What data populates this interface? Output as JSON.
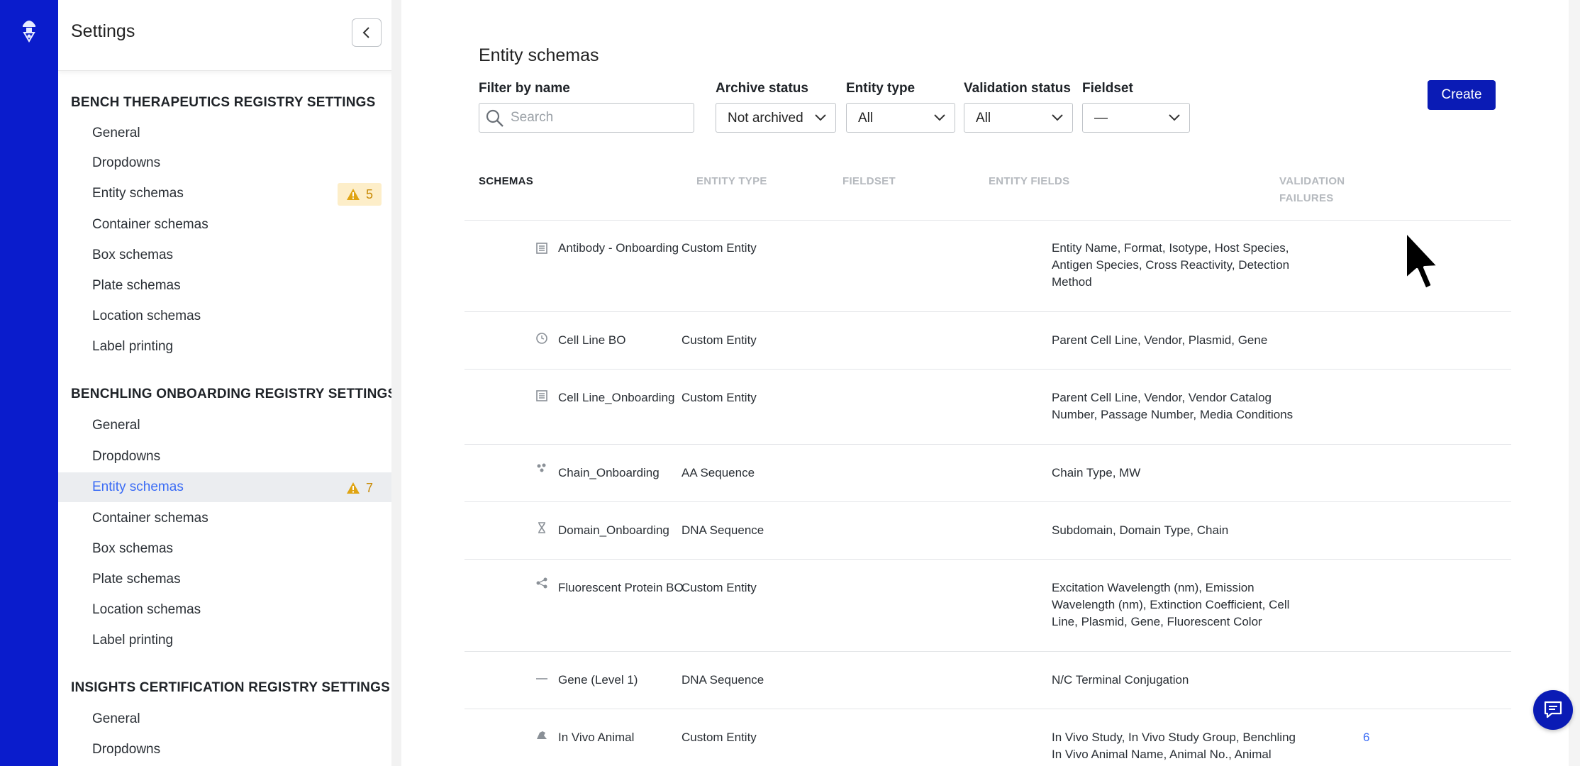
{
  "sidebar": {
    "title": "Settings",
    "sections": [
      {
        "title": "BENCH THERAPEUTICS REGISTRY SETTINGS",
        "items": [
          {
            "label": "General"
          },
          {
            "label": "Dropdowns"
          },
          {
            "label": "Entity schemas",
            "warning_count": "5"
          },
          {
            "label": "Container schemas"
          },
          {
            "label": "Box schemas"
          },
          {
            "label": "Plate schemas"
          },
          {
            "label": "Location schemas"
          },
          {
            "label": "Label printing"
          }
        ]
      },
      {
        "title": "BENCHLING ONBOARDING REGISTRY SETTINGS",
        "items": [
          {
            "label": "General"
          },
          {
            "label": "Dropdowns"
          },
          {
            "label": "Entity schemas",
            "warning_count": "7",
            "active": true
          },
          {
            "label": "Container schemas"
          },
          {
            "label": "Box schemas"
          },
          {
            "label": "Plate schemas"
          },
          {
            "label": "Location schemas"
          },
          {
            "label": "Label printing"
          }
        ]
      },
      {
        "title": "INSIGHTS CERTIFICATION REGISTRY SETTINGS",
        "items": [
          {
            "label": "General"
          },
          {
            "label": "Dropdowns"
          }
        ]
      }
    ]
  },
  "main": {
    "title": "Entity schemas",
    "filters": {
      "name_label": "Filter by name",
      "search_placeholder": "Search",
      "archive_label": "Archive status",
      "archive_value": "Not archived",
      "entity_type_label": "Entity type",
      "entity_type_value": "All",
      "validation_label": "Validation status",
      "validation_value": "All",
      "fieldset_label": "Fieldset",
      "fieldset_value": "—"
    },
    "create_label": "Create",
    "columns": {
      "schemas": "SCHEMAS",
      "entity_type": "ENTITY TYPE",
      "fieldset": "FIELDSET",
      "entity_fields": "ENTITY FIELDS",
      "validation_failures_1": "VALIDATION",
      "validation_failures_2": "FAILURES"
    },
    "rows": [
      {
        "icon": "list-icon",
        "name": "Antibody - Onboarding",
        "entity_type": "Custom Entity",
        "fieldset": "",
        "fields": [
          "Entity Name, Format, Isotype, Host Species,",
          "Antigen Species, Cross Reactivity, Detection",
          "Method"
        ],
        "failures": ""
      },
      {
        "icon": "clock-icon",
        "name": "Cell Line BO",
        "entity_type": "Custom Entity",
        "fieldset": "",
        "fields": [
          "Parent Cell Line, Vendor, Plasmid, Gene"
        ],
        "failures": ""
      },
      {
        "icon": "list-icon",
        "name": "Cell Line_Onboarding",
        "entity_type": "Custom Entity",
        "fieldset": "",
        "fields": [
          "Parent Cell Line, Vendor, Vendor Catalog",
          "Number, Passage Number, Media Conditions"
        ],
        "failures": ""
      },
      {
        "icon": "aa-sequence-icon",
        "name": "Chain_Onboarding",
        "entity_type": "AA Sequence",
        "fieldset": "",
        "fields": [
          "Chain Type, MW"
        ],
        "failures": ""
      },
      {
        "icon": "dna-icon",
        "name": "Domain_Onboarding",
        "entity_type": "DNA Sequence",
        "fieldset": "",
        "fields": [
          "Subdomain, Domain Type, Chain"
        ],
        "failures": ""
      },
      {
        "icon": "molecule-icon",
        "name": "Fluorescent Protein BO",
        "entity_type": "Custom Entity",
        "fieldset": "",
        "fields": [
          "Excitation Wavelength (nm), Emission",
          "Wavelength (nm), Extinction Coefficient, Cell",
          "Line, Plasmid, Gene, Fluorescent Color"
        ],
        "failures": ""
      },
      {
        "icon": "line-icon",
        "name": "Gene (Level 1)",
        "entity_type": "DNA Sequence",
        "fieldset": "",
        "fields": [
          "N/C Terminal Conjugation"
        ],
        "failures": ""
      },
      {
        "icon": "animal-icon",
        "name": "In Vivo Animal",
        "entity_type": "Custom Entity",
        "fieldset": "",
        "fields": [
          "In Vivo Study, In Vivo Study Group, Benchling",
          "In Vivo Animal Name, Animal No., Animal"
        ],
        "failures": "6"
      }
    ]
  },
  "colors": {
    "rail": "#0a1ccc",
    "primary_button": "#0a1bb5",
    "active_link": "#3b6cf5",
    "warning": "#c88a05",
    "warning_bg": "#fdeec9"
  }
}
